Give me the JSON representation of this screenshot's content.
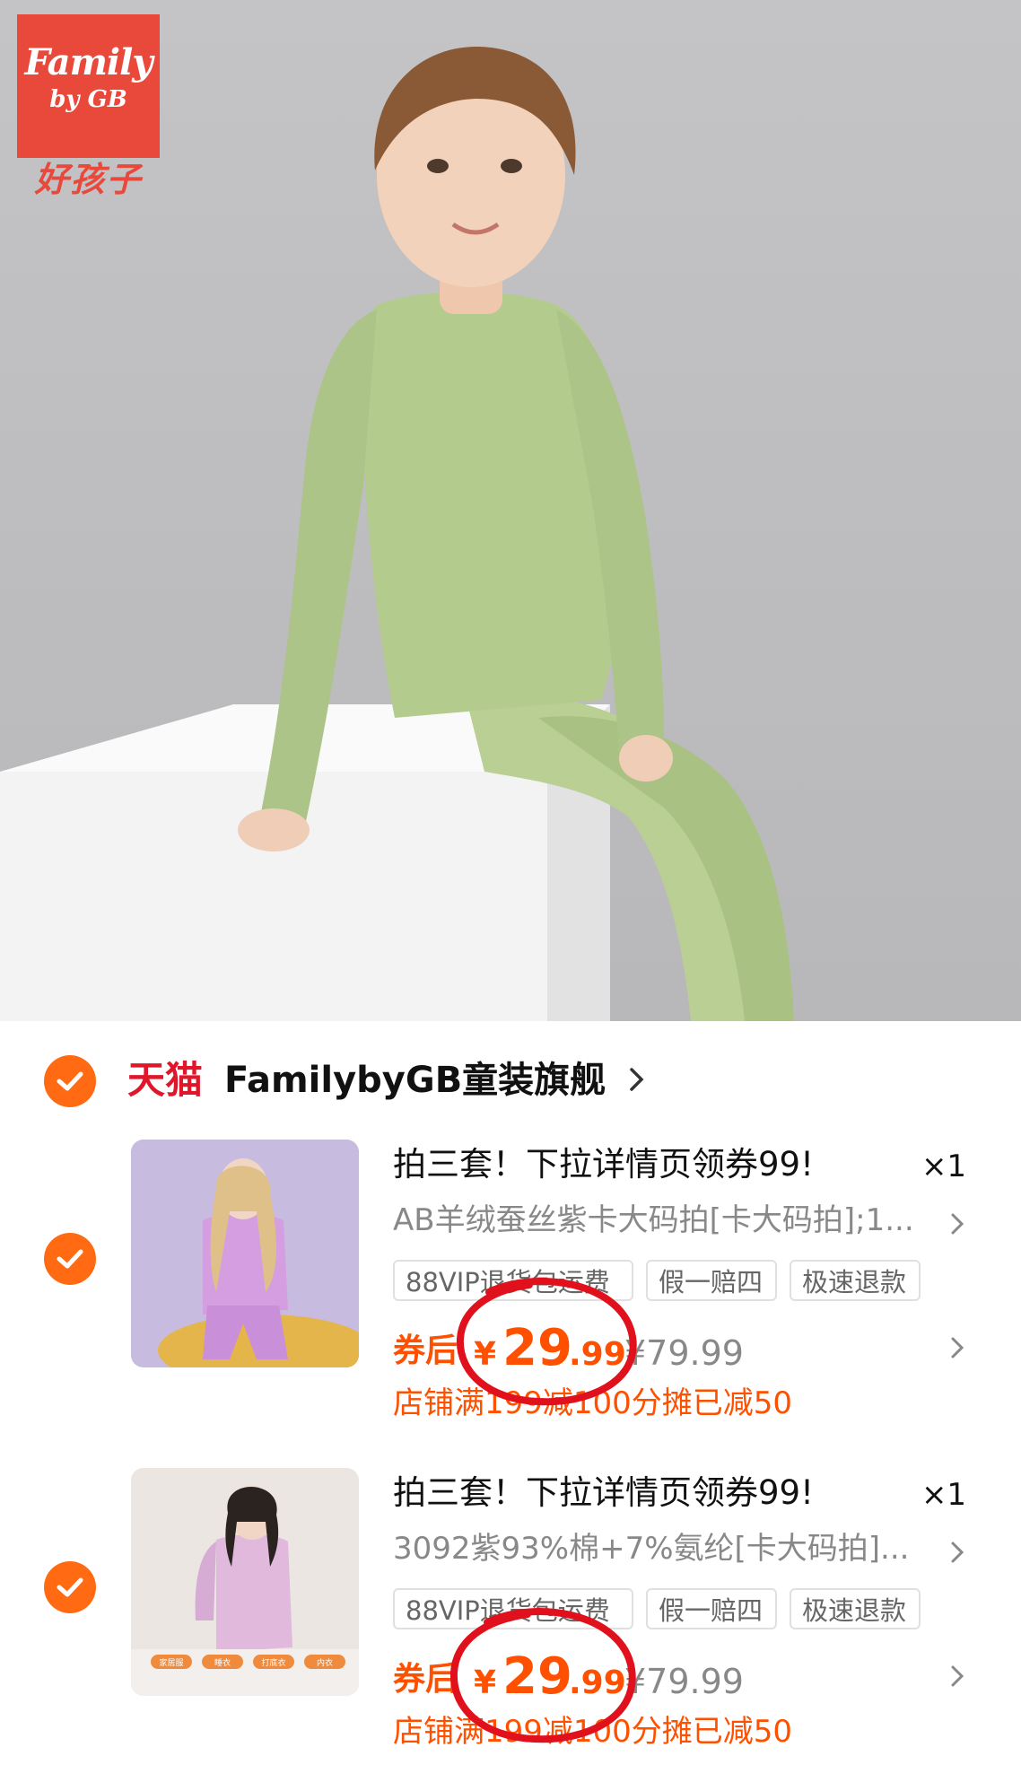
{
  "hero": {
    "brand_script": "Family",
    "brand_sub": "by GB",
    "brand_cn": "好孩子"
  },
  "shop": {
    "platform": "天猫",
    "name": "FamilybyGB童装旗舰"
  },
  "items": [
    {
      "title": "拍三套！下拉详情页领券99!",
      "qty": "×1",
      "spec": "AB羊绒蚕丝紫卡大码拍[卡大码拍];1...",
      "tags": [
        "88VIP退货包运费",
        "假一赔四",
        "极速退款"
      ],
      "after_label": "券后",
      "yen": "¥",
      "price_int": "29",
      "price_dec": ".99",
      "orig_price": "¥79.99",
      "promo": "店铺满199减100分摊已减50",
      "thumb_bg": "#c9bde0"
    },
    {
      "title": "拍三套！下拉详情页领券99!",
      "qty": "×1",
      "spec": "3092紫93%棉+7%氨纶[卡大码拍]...",
      "tags": [
        "88VIP退货包运费",
        "假一赔四",
        "极速退款"
      ],
      "after_label": "券后",
      "yen": "¥",
      "price_int": "29",
      "price_dec": ".99",
      "orig_price": "¥79.99",
      "promo": "店铺满199减100分摊已减50",
      "thumb_bg": "#ebe6e2",
      "thumb_badges": [
        "家居服",
        "睡衣",
        "打底衣",
        "内衣"
      ]
    }
  ],
  "colors": {
    "accent": "#ff5000",
    "check": "#ff6a12",
    "tmall_red": "#e0162b",
    "brand_red": "#e8493b",
    "annotation_red": "#e0101c"
  },
  "icons": [
    "check-icon",
    "chevron-right-icon"
  ]
}
